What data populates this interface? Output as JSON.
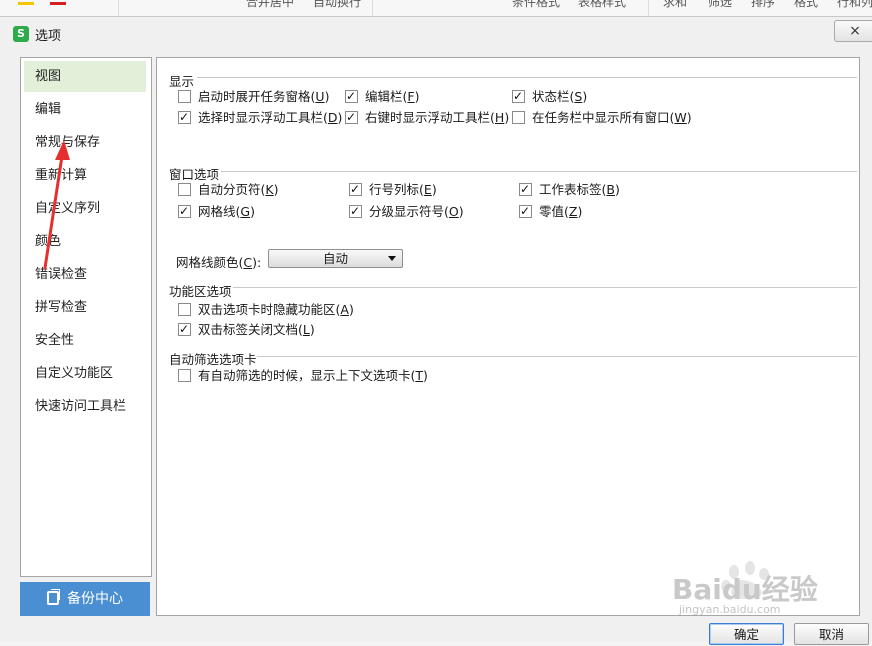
{
  "window": {
    "title": "选项",
    "close_label": "×"
  },
  "toolbar": {
    "items": [
      "合并居中",
      "自动换行",
      "条件格式",
      "表格样式",
      "求和",
      "筛选",
      "排序",
      "格式",
      "行和列"
    ]
  },
  "nav": {
    "items": [
      {
        "label": "视图",
        "active": true
      },
      {
        "label": "编辑"
      },
      {
        "label": "常规与保存"
      },
      {
        "label": "重新计算"
      },
      {
        "label": "自定义序列"
      },
      {
        "label": "颜色"
      },
      {
        "label": "错误检查"
      },
      {
        "label": "拼写检查"
      },
      {
        "label": "安全性"
      },
      {
        "label": "自定义功能区"
      },
      {
        "label": "快速访问工具栏"
      }
    ],
    "backup_label": "备份中心"
  },
  "display": {
    "heading": "显示",
    "options": [
      {
        "label": "启动时展开任务窗格",
        "key": "U",
        "checked": false
      },
      {
        "label": "编辑栏",
        "key": "F",
        "checked": true
      },
      {
        "label": "状态栏",
        "key": "S",
        "checked": true
      },
      {
        "label": "选择时显示浮动工具栏",
        "key": "D",
        "checked": true
      },
      {
        "label": "右键时显示浮动工具栏",
        "key": "H",
        "checked": true
      },
      {
        "label": "在任务栏中显示所有窗口",
        "key": "W",
        "checked": false
      }
    ]
  },
  "window_options": {
    "heading": "窗口选项",
    "options": [
      {
        "label": "自动分页符",
        "key": "K",
        "checked": false
      },
      {
        "label": "行号列标",
        "key": "E",
        "checked": true
      },
      {
        "label": "工作表标签",
        "key": "B",
        "checked": true
      },
      {
        "label": "网格线",
        "key": "G",
        "checked": true
      },
      {
        "label": "分级显示符号",
        "key": "O",
        "checked": true
      },
      {
        "label": "零值",
        "key": "Z",
        "checked": true
      }
    ],
    "gridline_color_label": "网格线颜色",
    "gridline_color_key": "C",
    "gridline_color_value": "自动"
  },
  "ribbon_options": {
    "heading": "功能区选项",
    "options": [
      {
        "label": "双击选项卡时隐藏功能区",
        "key": "A",
        "checked": false
      },
      {
        "label": "双击标签关闭文档",
        "key": "L",
        "checked": true
      }
    ]
  },
  "autofilter": {
    "heading": "自动筛选选项卡",
    "options": [
      {
        "label": "有自动筛选的时候，显示上下文选项卡",
        "key": "T",
        "checked": false
      }
    ]
  },
  "buttons": {
    "ok": "确定",
    "cancel": "取消"
  },
  "watermark": {
    "text": "Baidu经验",
    "url": "jingyan.baidu.com"
  },
  "colors": {
    "nav_active": "#e2efd9",
    "backup": "#4a8fd1",
    "arrow": "#e53030"
  }
}
